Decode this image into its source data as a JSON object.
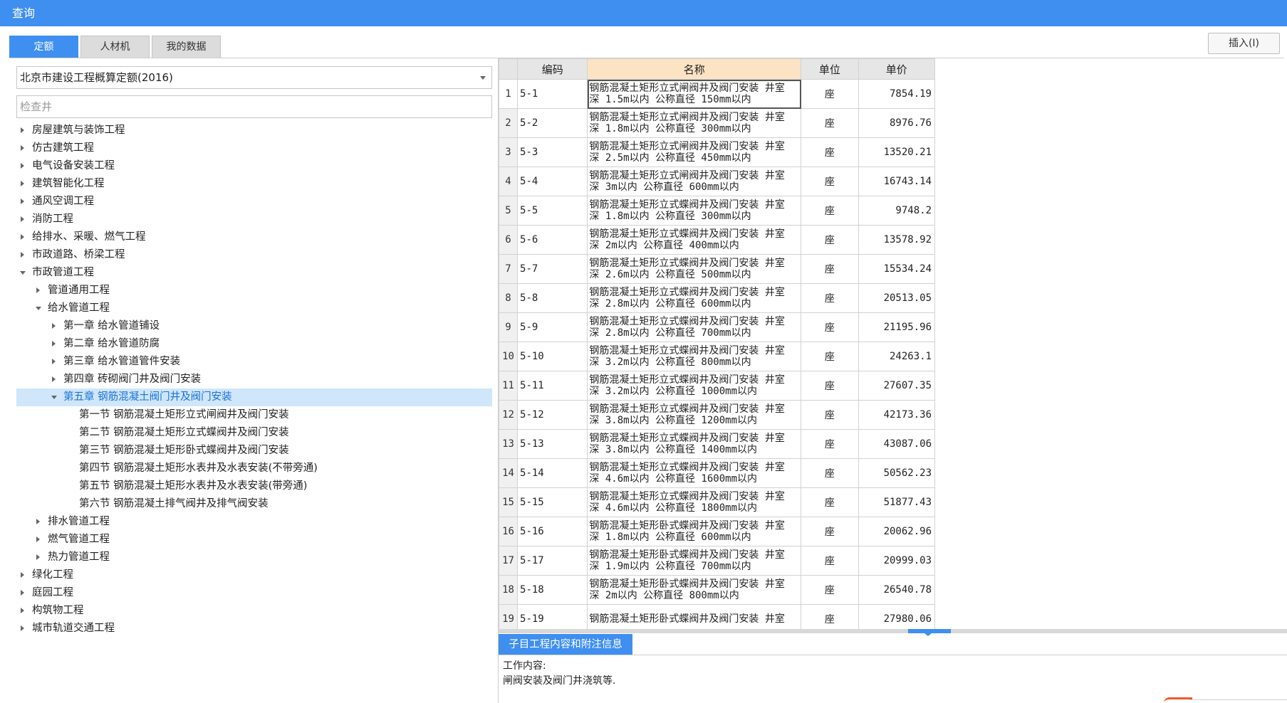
{
  "window": {
    "title": "查询"
  },
  "tabs": [
    {
      "label": "定额",
      "active": true
    },
    {
      "label": "人材机",
      "active": false
    },
    {
      "label": "我的数据",
      "active": false
    }
  ],
  "toolbar": {
    "insert_label": "插入(I)"
  },
  "quota_select": {
    "value": "北京市建设工程概算定额(2016)"
  },
  "search": {
    "placeholder": "检查井"
  },
  "tree": [
    {
      "label": "房屋建筑与装饰工程",
      "level": 0,
      "state": "collapsed"
    },
    {
      "label": "仿古建筑工程",
      "level": 0,
      "state": "collapsed"
    },
    {
      "label": "电气设备安装工程",
      "level": 0,
      "state": "collapsed"
    },
    {
      "label": "建筑智能化工程",
      "level": 0,
      "state": "collapsed"
    },
    {
      "label": "通风空调工程",
      "level": 0,
      "state": "collapsed"
    },
    {
      "label": "消防工程",
      "level": 0,
      "state": "collapsed"
    },
    {
      "label": "给排水、采暖、燃气工程",
      "level": 0,
      "state": "collapsed"
    },
    {
      "label": "市政道路、桥梁工程",
      "level": 0,
      "state": "collapsed"
    },
    {
      "label": "市政管道工程",
      "level": 0,
      "state": "expanded"
    },
    {
      "label": "管道通用工程",
      "level": 1,
      "state": "collapsed"
    },
    {
      "label": "给水管道工程",
      "level": 1,
      "state": "expanded"
    },
    {
      "label": "第一章 给水管道铺设",
      "level": 2,
      "state": "collapsed"
    },
    {
      "label": "第二章 给水管道防腐",
      "level": 2,
      "state": "collapsed"
    },
    {
      "label": "第三章 给水管道管件安装",
      "level": 2,
      "state": "collapsed"
    },
    {
      "label": "第四章 砖砌阀门井及阀门安装",
      "level": 2,
      "state": "collapsed"
    },
    {
      "label": "第五章 钢筋混凝土阀门井及阀门安装",
      "level": 2,
      "state": "expanded",
      "selected": true
    },
    {
      "label": "第一节 钢筋混凝土矩形立式闸阀井及阀门安装",
      "level": 3,
      "state": "leaf"
    },
    {
      "label": "第二节 钢筋混凝土矩形立式蝶阀井及阀门安装",
      "level": 3,
      "state": "leaf"
    },
    {
      "label": "第三节 钢筋混凝土矩形卧式蝶阀井及阀门安装",
      "level": 3,
      "state": "leaf"
    },
    {
      "label": "第四节 钢筋混凝土矩形水表井及水表安装(不带旁通)",
      "level": 3,
      "state": "leaf"
    },
    {
      "label": "第五节 钢筋混凝土矩形水表井及水表安装(带旁通)",
      "level": 3,
      "state": "leaf"
    },
    {
      "label": "第六节 钢筋混凝土排气阀井及排气阀安装",
      "level": 3,
      "state": "leaf"
    },
    {
      "label": "排水管道工程",
      "level": 1,
      "state": "collapsed"
    },
    {
      "label": "燃气管道工程",
      "level": 1,
      "state": "collapsed"
    },
    {
      "label": "热力管道工程",
      "level": 1,
      "state": "collapsed"
    },
    {
      "label": "绿化工程",
      "level": 0,
      "state": "collapsed"
    },
    {
      "label": "庭园工程",
      "level": 0,
      "state": "collapsed"
    },
    {
      "label": "构筑物工程",
      "level": 0,
      "state": "collapsed"
    },
    {
      "label": "城市轨道交通工程",
      "level": 0,
      "state": "collapsed"
    }
  ],
  "grid": {
    "columns": [
      "",
      "编码",
      "名称",
      "单位",
      "单价"
    ],
    "rows": [
      {
        "n": "1",
        "code": "5-1",
        "name1": "钢筋混凝土矩形立式闸阀井及阀门安装 井室",
        "name2": "深 1.5m以内 公称直径 150mm以内",
        "unit": "座",
        "price": "7854.19"
      },
      {
        "n": "2",
        "code": "5-2",
        "name1": "钢筋混凝土矩形立式闸阀井及阀门安装 井室",
        "name2": "深 1.8m以内 公称直径 300mm以内",
        "unit": "座",
        "price": "8976.76"
      },
      {
        "n": "3",
        "code": "5-3",
        "name1": "钢筋混凝土矩形立式闸阀井及阀门安装 井室",
        "name2": "深 2.5m以内 公称直径 450mm以内",
        "unit": "座",
        "price": "13520.21"
      },
      {
        "n": "4",
        "code": "5-4",
        "name1": "钢筋混凝土矩形立式闸阀井及阀门安装 井室",
        "name2": "深 3m以内 公称直径 600mm以内",
        "unit": "座",
        "price": "16743.14"
      },
      {
        "n": "5",
        "code": "5-5",
        "name1": "钢筋混凝土矩形立式蝶阀井及阀门安装 井室",
        "name2": "深 1.8m以内 公称直径 300mm以内",
        "unit": "座",
        "price": "9748.2"
      },
      {
        "n": "6",
        "code": "5-6",
        "name1": "钢筋混凝土矩形立式蝶阀井及阀门安装 井室",
        "name2": "深 2m以内 公称直径 400mm以内",
        "unit": "座",
        "price": "13578.92"
      },
      {
        "n": "7",
        "code": "5-7",
        "name1": "钢筋混凝土矩形立式蝶阀井及阀门安装 井室",
        "name2": "深 2.6m以内 公称直径 500mm以内",
        "unit": "座",
        "price": "15534.24"
      },
      {
        "n": "8",
        "code": "5-8",
        "name1": "钢筋混凝土矩形立式蝶阀井及阀门安装 井室",
        "name2": "深 2.8m以内 公称直径 600mm以内",
        "unit": "座",
        "price": "20513.05"
      },
      {
        "n": "9",
        "code": "5-9",
        "name1": "钢筋混凝土矩形立式蝶阀井及阀门安装 井室",
        "name2": "深 2.8m以内 公称直径 700mm以内",
        "unit": "座",
        "price": "21195.96"
      },
      {
        "n": "10",
        "code": "5-10",
        "name1": "钢筋混凝土矩形立式蝶阀井及阀门安装 井室",
        "name2": "深 3.2m以内 公称直径 800mm以内",
        "unit": "座",
        "price": "24263.1"
      },
      {
        "n": "11",
        "code": "5-11",
        "name1": "钢筋混凝土矩形立式蝶阀井及阀门安装 井室",
        "name2": "深 3.2m以内 公称直径 1000mm以内",
        "unit": "座",
        "price": "27607.35"
      },
      {
        "n": "12",
        "code": "5-12",
        "name1": "钢筋混凝土矩形立式蝶阀井及阀门安装 井室",
        "name2": "深 3.8m以内 公称直径 1200mm以内",
        "unit": "座",
        "price": "42173.36"
      },
      {
        "n": "13",
        "code": "5-13",
        "name1": "钢筋混凝土矩形立式蝶阀井及阀门安装 井室",
        "name2": "深 3.8m以内 公称直径 1400mm以内",
        "unit": "座",
        "price": "43087.06"
      },
      {
        "n": "14",
        "code": "5-14",
        "name1": "钢筋混凝土矩形立式蝶阀井及阀门安装 井室",
        "name2": "深 4.6m以内 公称直径 1600mm以内",
        "unit": "座",
        "price": "50562.23"
      },
      {
        "n": "15",
        "code": "5-15",
        "name1": "钢筋混凝土矩形立式蝶阀井及阀门安装 井室",
        "name2": "深 4.6m以内 公称直径 1800mm以内",
        "unit": "座",
        "price": "51877.43"
      },
      {
        "n": "16",
        "code": "5-16",
        "name1": "钢筋混凝土矩形卧式蝶阀井及阀门安装 井室",
        "name2": "深 1.8m以内 公称直径 600mm以内",
        "unit": "座",
        "price": "20062.96"
      },
      {
        "n": "17",
        "code": "5-17",
        "name1": "钢筋混凝土矩形卧式蝶阀井及阀门安装 井室",
        "name2": "深 1.9m以内 公称直径 700mm以内",
        "unit": "座",
        "price": "20999.03"
      },
      {
        "n": "18",
        "code": "5-18",
        "name1": "钢筋混凝土矩形卧式蝶阀井及阀门安装 井室",
        "name2": "深 2m以内 公称直径 800mm以内",
        "unit": "座",
        "price": "26540.78"
      },
      {
        "n": "19",
        "code": "5-19",
        "name1": "钢筋混凝土矩形卧式蝶阀井及阀门安装 井室",
        "name2": "",
        "unit": "座",
        "price": "27980.06"
      }
    ]
  },
  "info_panel": {
    "tab_label": "子目工程内容和附注信息",
    "line1": "工作内容:",
    "line2": "闸阀安装及阀门井浇筑等."
  },
  "colors": {
    "accent": "#3f8ff0",
    "sorted_header": "#fbe3c4",
    "selected_row": "#cfe6fb"
  }
}
